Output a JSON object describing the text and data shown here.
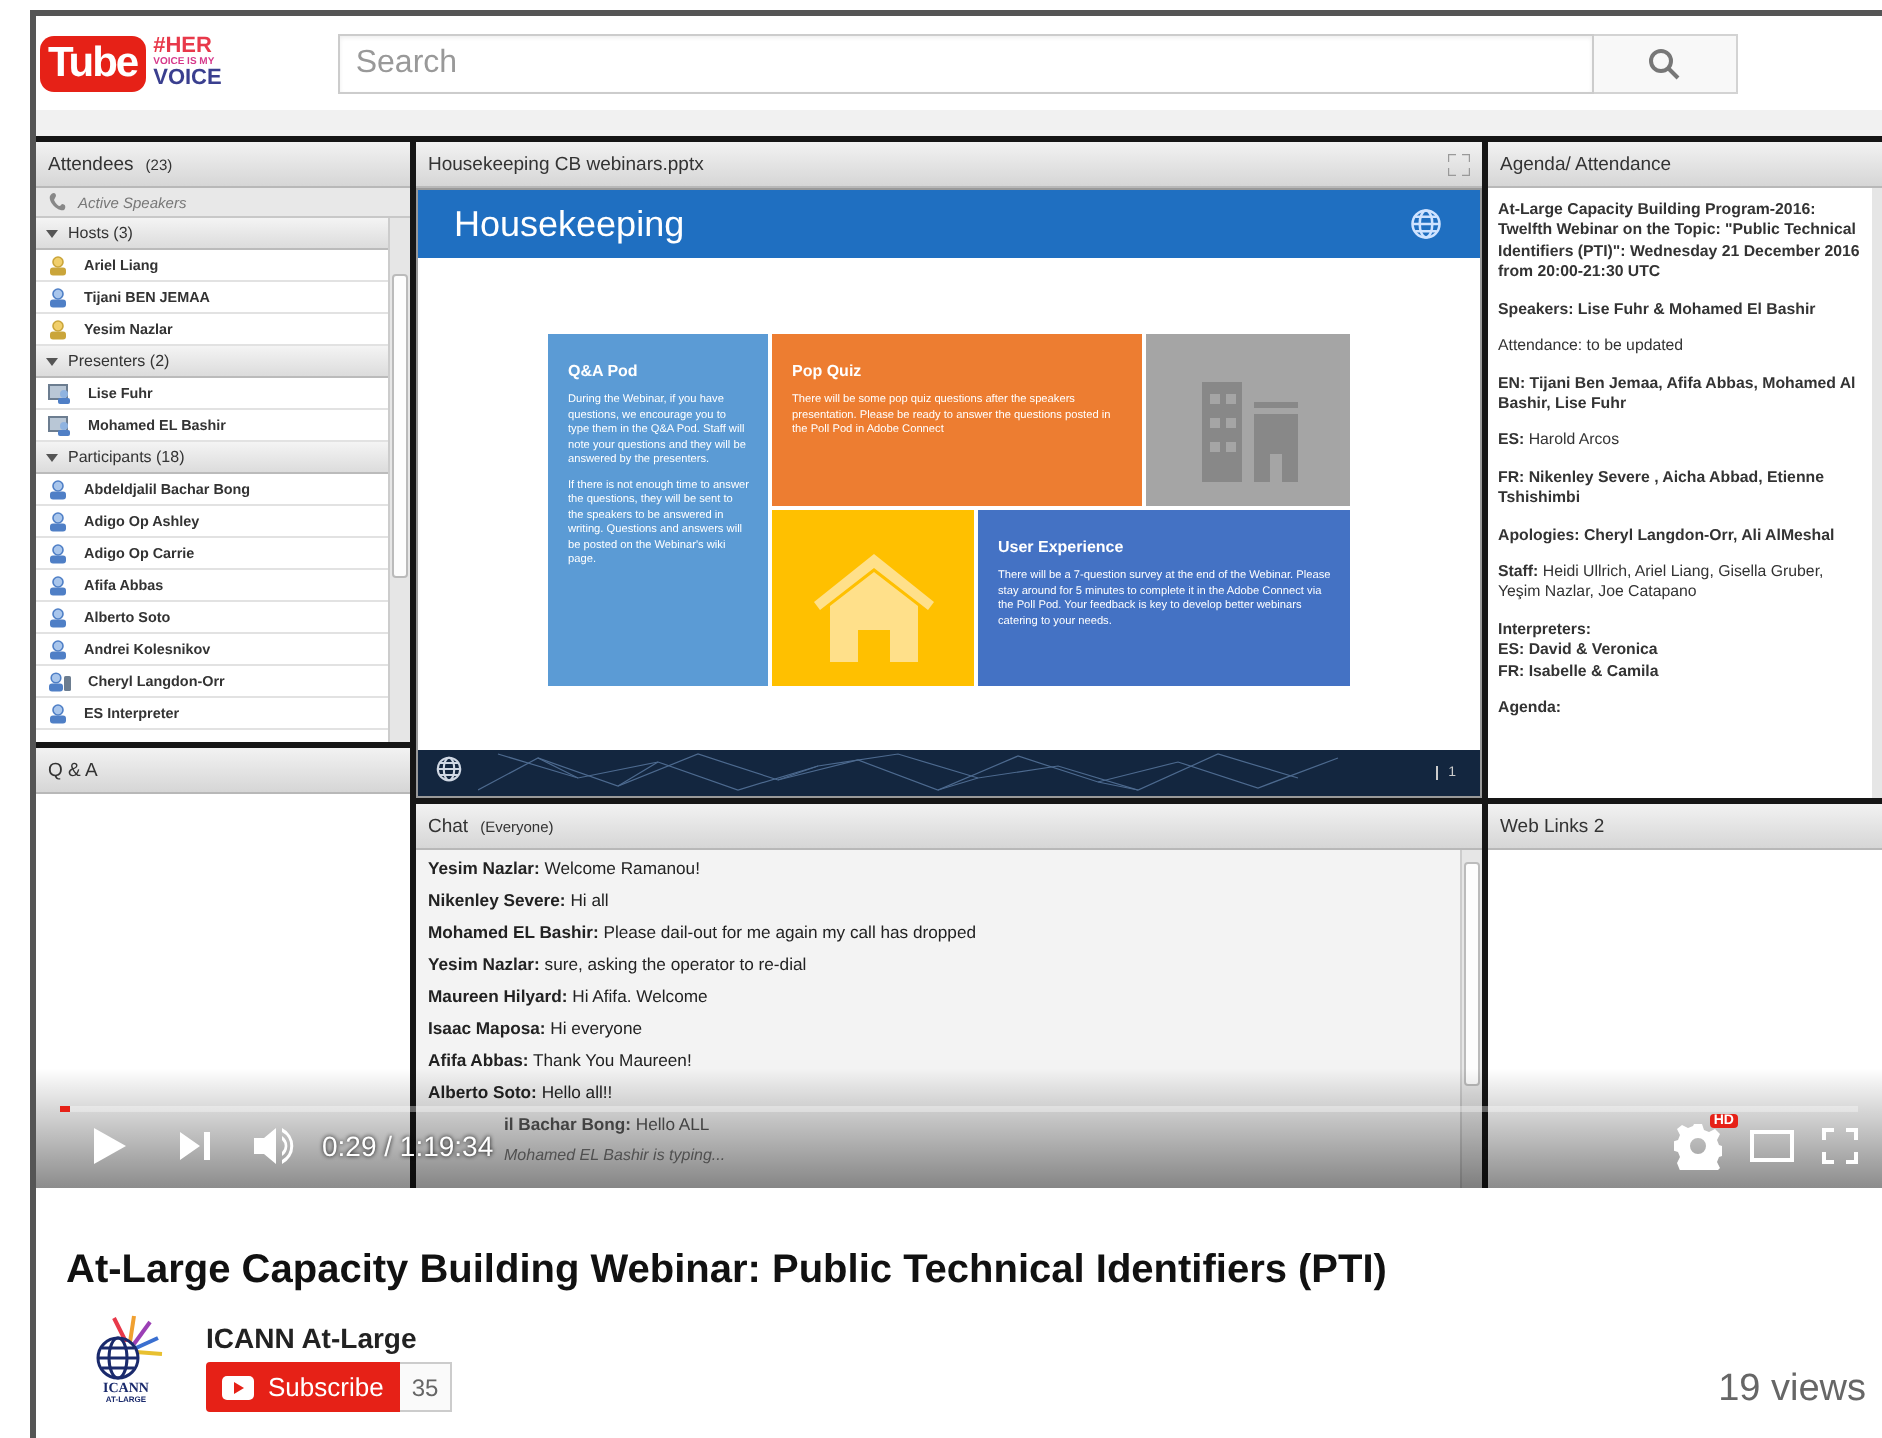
{
  "header": {
    "logo": {
      "brand": "Tube",
      "tag_1": "#HER",
      "tag_2": "VOICE IS MY",
      "tag_3": "VOICE"
    },
    "search": {
      "placeholder": "Search"
    }
  },
  "video": {
    "attendees": {
      "title": "Attendees",
      "count": "(23)",
      "active_speakers": "Active Speakers",
      "groups": [
        {
          "label": "Hosts (3)",
          "expanded": true,
          "children": [
            {
              "name": "Ariel Liang",
              "kind": "host"
            },
            {
              "name": "Tijani BEN JEMAA",
              "kind": "participant"
            },
            {
              "name": "Yesim Nazlar",
              "kind": "host"
            }
          ]
        },
        {
          "label": "Presenters (2)",
          "expanded": true,
          "children": [
            {
              "name": "Lise Fuhr",
              "kind": "presenter"
            },
            {
              "name": "Mohamed EL Bashir",
              "kind": "presenter"
            }
          ]
        },
        {
          "label": "Participants (18)",
          "expanded": true,
          "children": [
            {
              "name": "Abdeldjalil Bachar Bong",
              "kind": "participant"
            },
            {
              "name": "Adigo Op Ashley",
              "kind": "participant"
            },
            {
              "name": "Adigo Op Carrie",
              "kind": "participant"
            },
            {
              "name": "Afifa Abbas",
              "kind": "participant"
            },
            {
              "name": "Alberto Soto",
              "kind": "participant"
            },
            {
              "name": "Andrei Kolesnikov",
              "kind": "participant"
            },
            {
              "name": "Cheryl Langdon-Orr",
              "kind": "phone"
            },
            {
              "name": "ES Interpreter",
              "kind": "participant"
            }
          ]
        }
      ]
    },
    "qa": {
      "title": "Q & A"
    },
    "share": {
      "title": "Housekeeping CB webinars.pptx",
      "slide": {
        "title": "Housekeeping",
        "page": "1",
        "tiles": [
          {
            "kind": "text",
            "color": "#5b9bd5",
            "heading": "Q&A Pod",
            "paragraphs": [
              "During the Webinar, if you have questions, we encourage you to type them in the Q&A Pod. Staff will note your questions and they will be answered by the presenters.",
              "If there is not enough time to answer the questions, they will be sent to the speakers to be answered in writing. Questions and answers will be posted on the Webinar's wiki page."
            ]
          },
          {
            "kind": "text",
            "color": "#ed7d31",
            "heading": "Pop Quiz",
            "paragraphs": [
              "There will be some pop quiz questions after the speakers presentation. Please be ready to answer the questions posted in the Poll Pod in Adobe Connect"
            ]
          },
          {
            "kind": "building",
            "color": "#a5a5a5"
          },
          {
            "kind": "house",
            "color": "#ffc000"
          },
          {
            "kind": "text",
            "color": "#4472c4",
            "heading": "User Experience",
            "paragraphs": [
              "There will be a 7-question survey at the end of the Webinar. Please stay around for 5 minutes to complete it in the Adobe Connect via the Poll Pod. Your feedback is key to develop better webinars catering to your needs."
            ]
          }
        ]
      }
    },
    "agenda": {
      "title": "Agenda/ Attendance",
      "paragraphs": [
        {
          "bold": true,
          "lines": [
            "At-Large Capacity Building Program-2016: Twelfth Webinar on the Topic: \"Public Technical Identifiers (PTI)\": Wednesday 21 December 2016 from 20:00-21:30 UTC"
          ]
        },
        {
          "bold": true,
          "lines": [
            "Speakers: Lise Fuhr & Mohamed El Bashir"
          ]
        },
        {
          "bold": false,
          "lines": [
            "Attendance: to be updated"
          ]
        },
        {
          "bold": true,
          "lines": [
            "EN: Tijani Ben Jemaa,  Afifa Abbas, Mohamed Al Bashir, Lise Fuhr"
          ]
        },
        {
          "bold": false,
          "lines": [
            "**ES:** Harold Arcos"
          ]
        },
        {
          "bold": true,
          "lines": [
            "FR:  Nikenley Severe , Aicha Abbad, Etienne Tshishimbi"
          ]
        },
        {
          "bold": true,
          "lines": [
            "Apologies: Cheryl Langdon-Orr, Ali AlMeshal"
          ]
        },
        {
          "bold": false,
          "lines": [
            "**Staff:** Heidi Ullrich, Ariel Liang, Gisella Gruber, Yeşim Nazlar, Joe Catapano"
          ]
        },
        {
          "bold": true,
          "lines": [
            "Interpreters:",
            "ES: David & Veronica",
            "FR: Isabelle & Camila"
          ]
        },
        {
          "bold": true,
          "lines": [
            "Agenda:"
          ]
        }
      ]
    },
    "chat": {
      "title": "Chat",
      "audience": "(Everyone)",
      "messages": [
        {
          "sender": "Yesim Nazlar:",
          "text": "Welcome Ramanou!",
          "covered": false
        },
        {
          "sender": "Nikenley Severe:",
          "text": "Hi all",
          "covered": false
        },
        {
          "sender": "Mohamed EL Bashir:",
          "text": "Please dail-out for me again my call has dropped",
          "covered": false
        },
        {
          "sender": "Yesim Nazlar:",
          "text": "sure, asking the operator to re-dial",
          "covered": false
        },
        {
          "sender": "Maureen Hilyard:",
          "text": "Hi Afifa. Welcome",
          "covered": false
        },
        {
          "sender": "Isaac Maposa:",
          "text": "Hi everyone",
          "covered": false
        },
        {
          "sender": "Afifa Abbas:",
          "text": "Thank You Maureen!",
          "covered": false
        },
        {
          "sender": "Alberto Soto:",
          "text": "Hello all!!",
          "covered": false
        },
        {
          "sender": "il Bachar Bong:",
          "text": "Hello ALL",
          "covered": true
        }
      ],
      "typing": "Mohamed EL Bashir is typing..."
    },
    "web_links": {
      "title": "Web Links 2"
    },
    "player": {
      "progress": {
        "level": 0.006
      },
      "time": "0:29 / 1:19:34",
      "hd": "HD"
    }
  },
  "title": "At-Large Capacity Building Webinar: Public Technical Identifiers (PTI)",
  "channel": {
    "logo": {
      "line_1": "ICANN",
      "line_2": "AT-LARGE"
    },
    "name": "ICANN At-Large",
    "subscribe": "Subscribe",
    "subscribers": "35"
  },
  "views": "19 views"
}
